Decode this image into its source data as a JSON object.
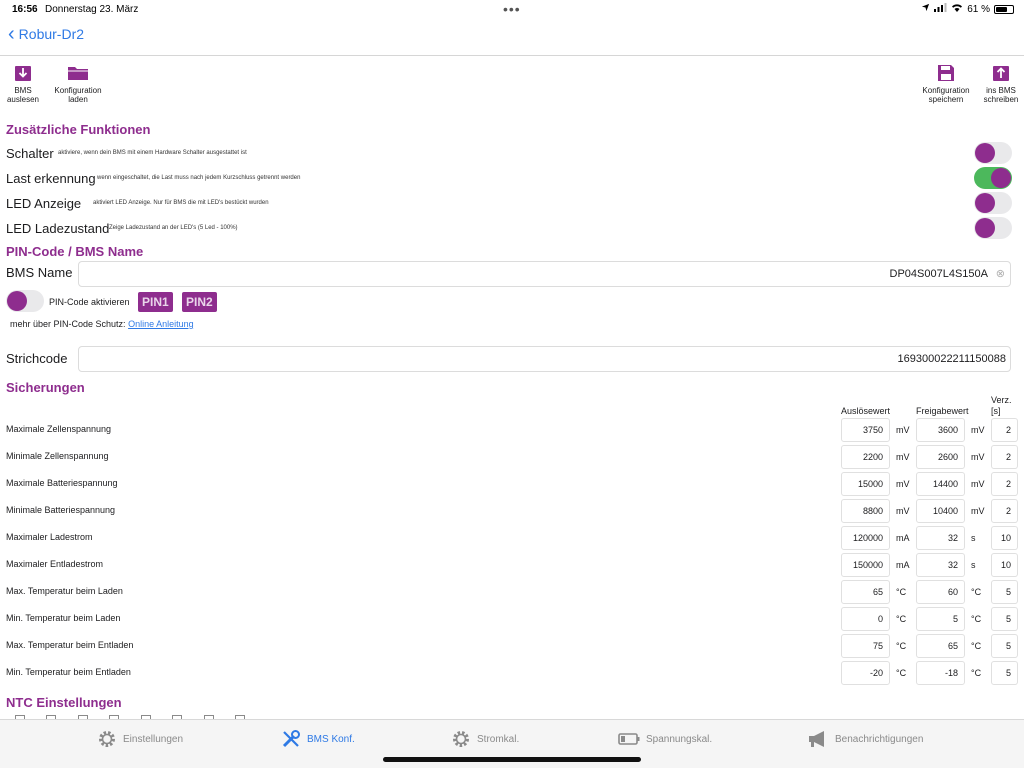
{
  "status": {
    "time": "16:56",
    "date": "Donnerstag 23. März",
    "battery": "61 %"
  },
  "nav": {
    "back_label": "Robur-Dr2"
  },
  "toolbar": {
    "read_bms": "BMS\nauslesen",
    "load_config": "Konfiguration\nladen",
    "save_config": "Konfiguration\nspeichern",
    "write_bms": "ins BMS\nschreiben"
  },
  "features": {
    "title": "Zusätzliche Funktionen",
    "items": [
      {
        "label": "Schalter",
        "desc": "aktiviere, wenn dein BMS mit einem Hardware Schalter ausgestattet ist",
        "on": false
      },
      {
        "label": "Last erkennung",
        "desc": "wenn eingeschaltet, die Last muss nach jedem Kurzschluss getrennt werden",
        "on": true
      },
      {
        "label": "LED Anzeige",
        "desc": "aktiviert LED Anzeige. Nur für BMS die mit LED's bestückt wurden",
        "on": false
      },
      {
        "label": "LED Ladezustand",
        "desc": "Zeige Ladezustand an der LED's (5 Led - 100%)",
        "on": false
      }
    ]
  },
  "pin": {
    "title": "PIN-Code / BMS Name",
    "bms_name_label": "BMS Name",
    "bms_name_value": "DP04S007L4S150A",
    "pin_toggle_label": "PIN-Code aktivieren",
    "pin_active": false,
    "pin1": "PIN1",
    "pin2": "PIN2",
    "more_info": "mehr über PIN-Code Schutz:",
    "more_link": "Online Anleitung",
    "barcode_label": "Strichcode",
    "barcode_value": "169300022211150088"
  },
  "protections": {
    "title": "Sicherungen",
    "col_trigger": "Auslösewert",
    "col_release": "Freigabewert",
    "col_delay": "Verz.\n[s]",
    "rows": [
      {
        "label": "Maximale Zellenspannung",
        "trigger": "3750",
        "trigger_unit": "mV",
        "release": "3600",
        "release_unit": "mV",
        "delay": "2"
      },
      {
        "label": "Minimale Zellenspannung",
        "trigger": "2200",
        "trigger_unit": "mV",
        "release": "2600",
        "release_unit": "mV",
        "delay": "2"
      },
      {
        "label": "Maximale Batteriespannung",
        "trigger": "15000",
        "trigger_unit": "mV",
        "release": "14400",
        "release_unit": "mV",
        "delay": "2"
      },
      {
        "label": "Minimale Batteriespannung",
        "trigger": "8800",
        "trigger_unit": "mV",
        "release": "10400",
        "release_unit": "mV",
        "delay": "2"
      },
      {
        "label": "Maximaler Ladestrom",
        "trigger": "120000",
        "trigger_unit": "mA",
        "release": "32",
        "release_unit": "s",
        "delay": "10"
      },
      {
        "label": "Maximaler Entladestrom",
        "trigger": "150000",
        "trigger_unit": "mA",
        "release": "32",
        "release_unit": "s",
        "delay": "10"
      },
      {
        "label": "Max. Temperatur beim Laden",
        "trigger": "65",
        "trigger_unit": "°C",
        "release": "60",
        "release_unit": "°C",
        "delay": "5"
      },
      {
        "label": "Min. Temperatur beim Laden",
        "trigger": "0",
        "trigger_unit": "°C",
        "release": "5",
        "release_unit": "°C",
        "delay": "5"
      },
      {
        "label": "Max. Temperatur beim Entladen",
        "trigger": "75",
        "trigger_unit": "°C",
        "release": "65",
        "release_unit": "°C",
        "delay": "5"
      },
      {
        "label": "Min. Temperatur beim Entladen",
        "trigger": "-20",
        "trigger_unit": "°C",
        "release": "-18",
        "release_unit": "°C",
        "delay": "5"
      }
    ]
  },
  "ntc": {
    "title": "NTC Einstellungen"
  },
  "tabs": [
    {
      "label": "Einstellungen",
      "icon": "gear-icon",
      "active": false
    },
    {
      "label": "BMS Konf.",
      "icon": "wrench-screwdriver-icon",
      "active": true
    },
    {
      "label": "Stromkal.",
      "icon": "gear-icon",
      "active": false
    },
    {
      "label": "Spannungskal.",
      "icon": "battery-icon",
      "active": false
    },
    {
      "label": "Benachrichtigungen",
      "icon": "megaphone-icon",
      "active": false
    }
  ],
  "colors": {
    "accent": "#8e2d8e",
    "link": "#2f7ae5",
    "toggle_on": "#4cb85c"
  }
}
